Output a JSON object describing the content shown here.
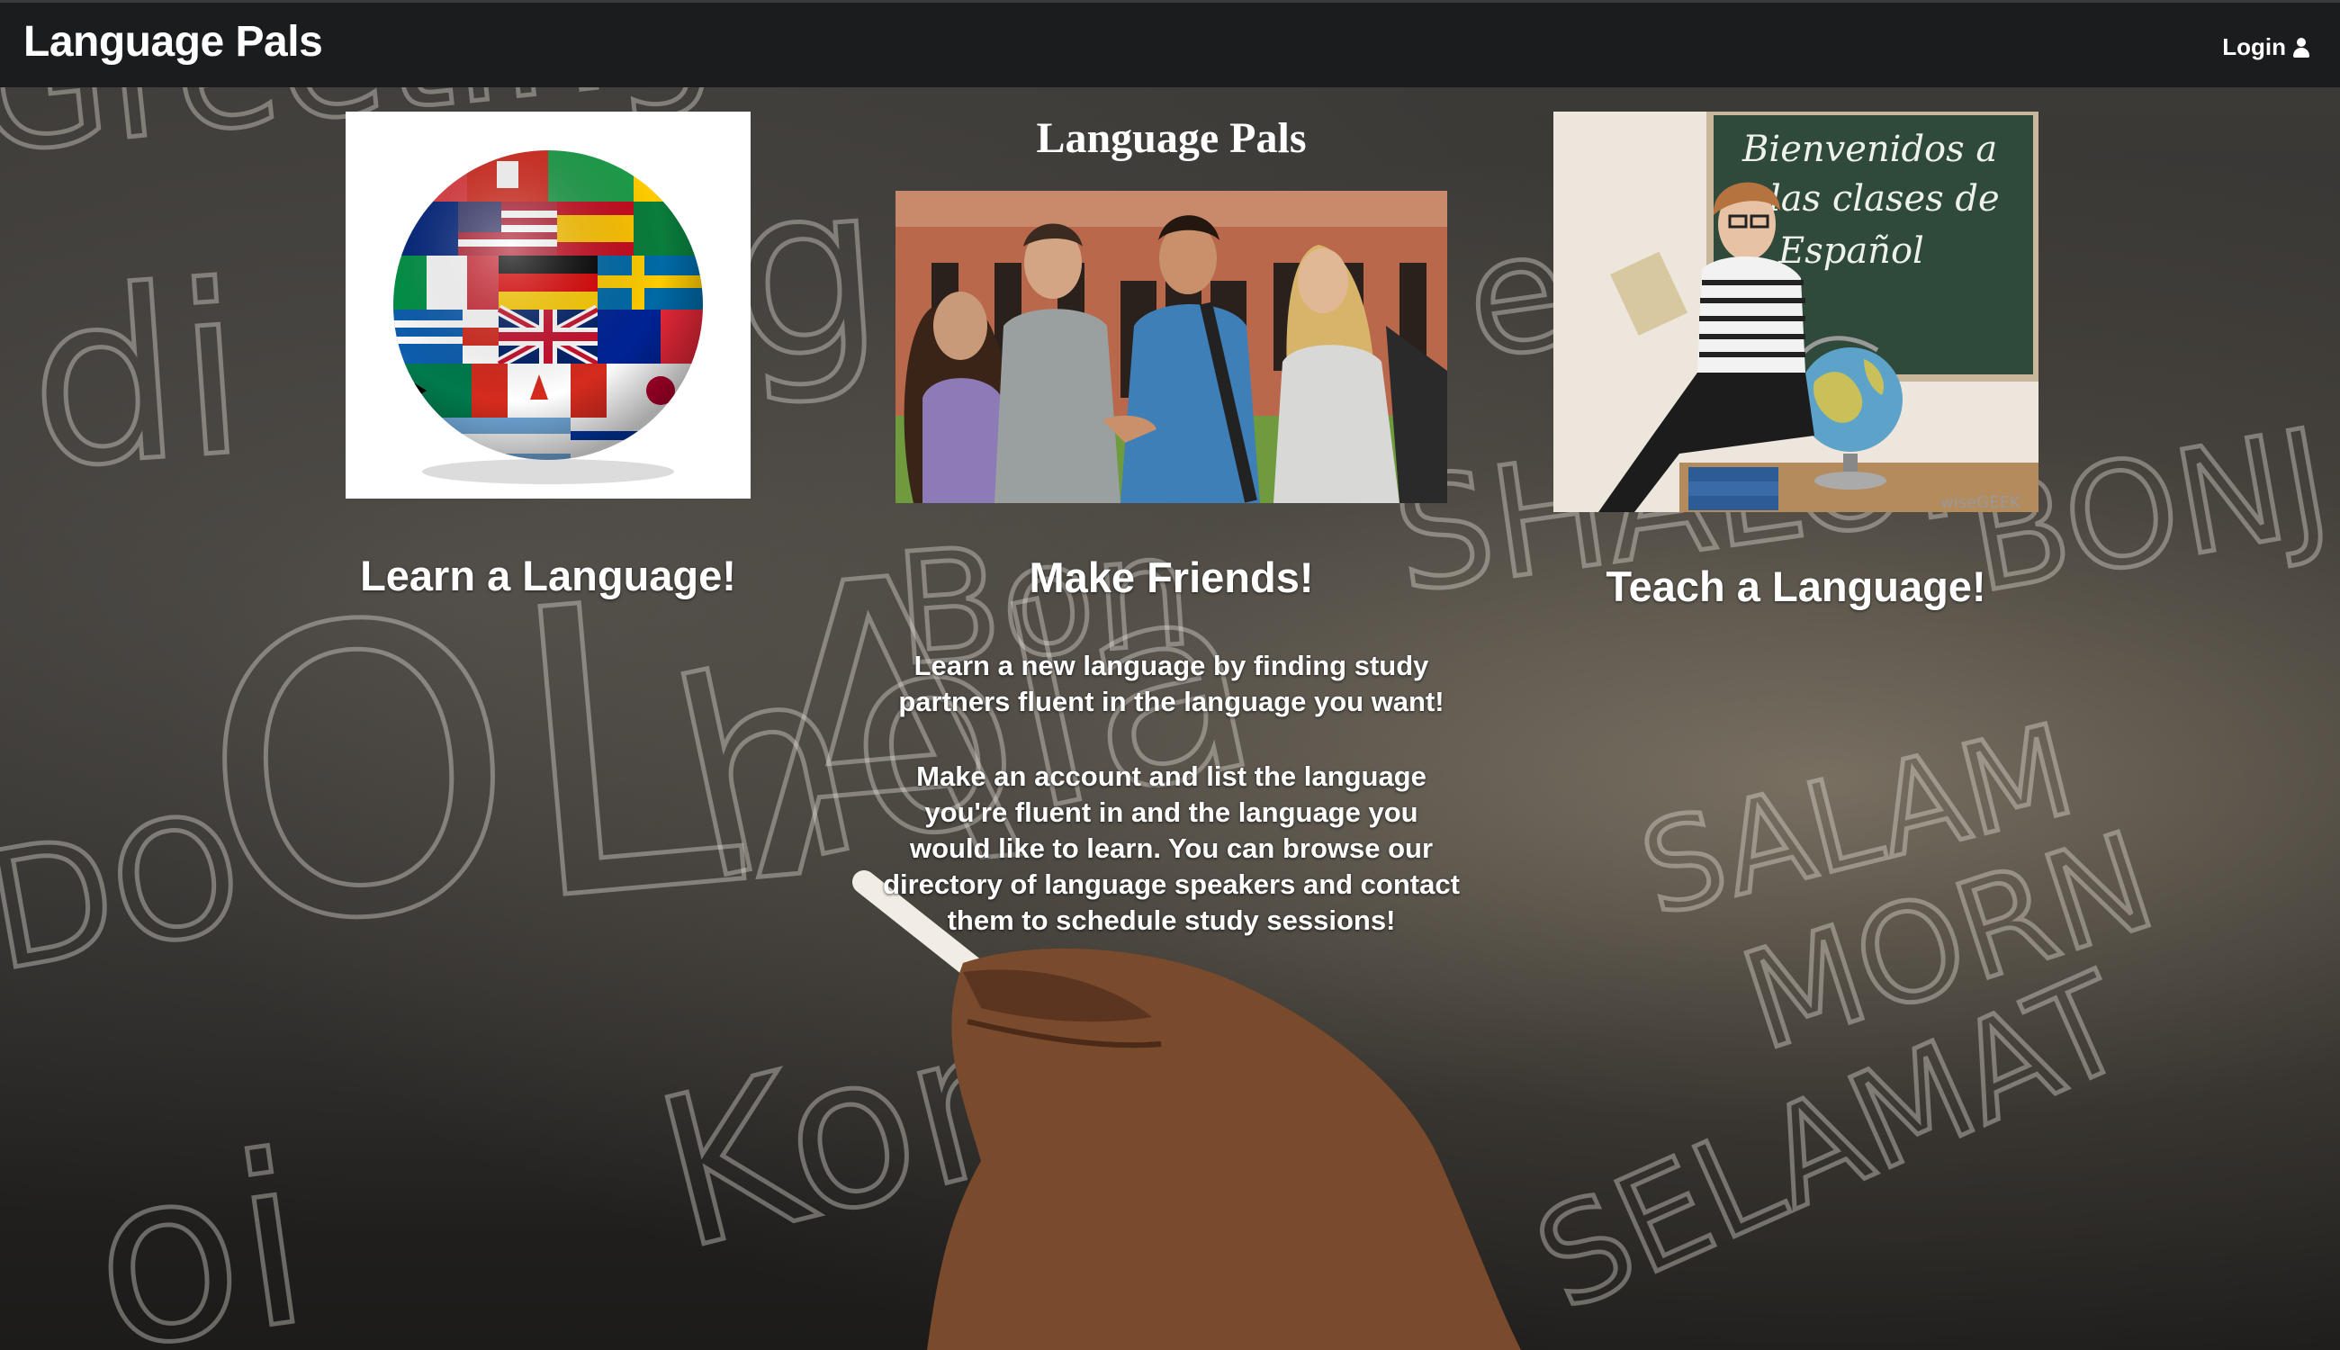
{
  "navbar": {
    "brand": "Language Pals",
    "login_label": "Login",
    "login_icon": "user-icon"
  },
  "main": {
    "title": "Language Pals",
    "columns": [
      {
        "heading": "Learn a Language!",
        "image": "flag-globe"
      },
      {
        "heading": "Make Friends!",
        "image": "students-talking"
      },
      {
        "heading": "Teach a Language!",
        "image": "teacher-chalkboard"
      }
    ],
    "description": [
      "Learn a new language by finding study partners fluent in the language you want!",
      "Make an account and list the language you're fluent in and the language you would like to learn. You can browse our directory of language speakers and contact them to schedule study sessions!"
    ],
    "teacher_board": {
      "line1": "Bienvenidos a",
      "line2": "las clases de",
      "line3": "Español",
      "watermark": "wiseGEEK"
    }
  },
  "colors": {
    "navbar": "#1b1c1e",
    "text": "#ffffff",
    "chalkboard": "#2e2c29"
  }
}
